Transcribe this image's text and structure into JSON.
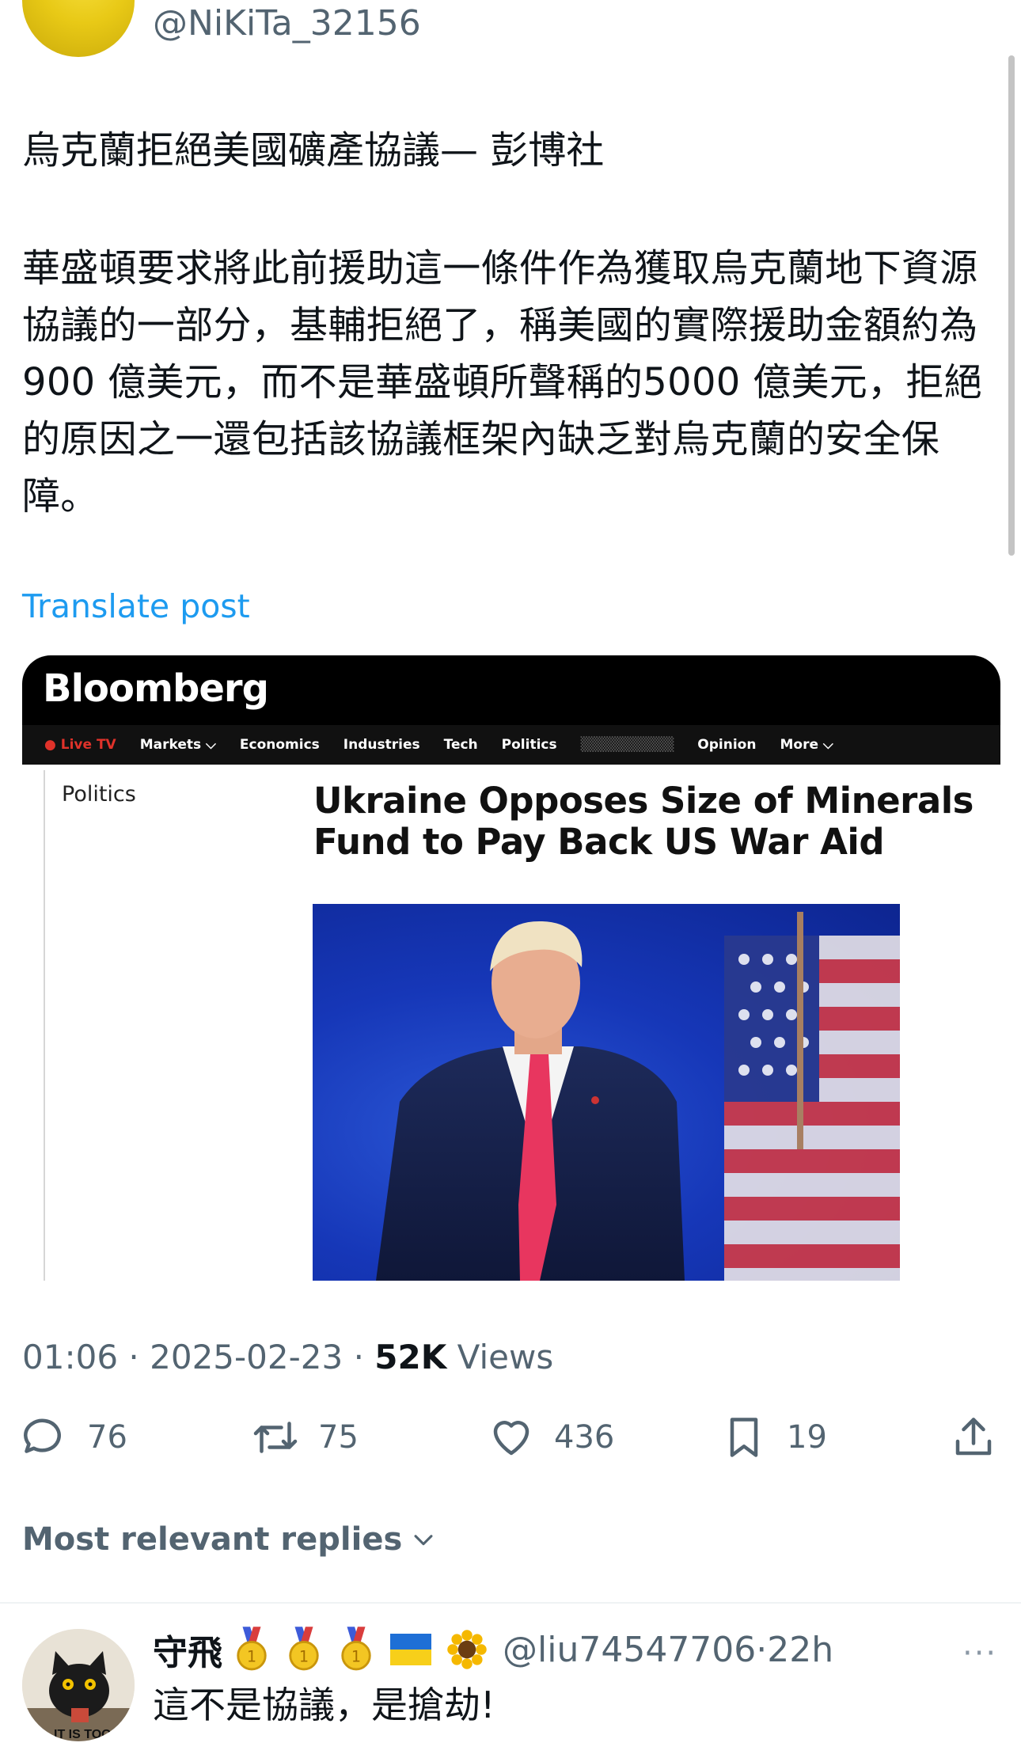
{
  "author": {
    "handle": "@NiKiTa_32156"
  },
  "post": {
    "title": "烏克蘭拒絕美國礦產協議— 彭博社",
    "body": "華盛頓要求將此前援助這一條件作為獲取烏克蘭地下資源協議的一部分，基輔拒絕了，稱美國的實際援助金額約為 900 億美元，而不是華盛頓所聲稱的5000 億美元，拒絕的原因之一還包括該協議框架內缺乏對烏克蘭的安全保障。",
    "translate_label": "Translate post"
  },
  "embed": {
    "brand": "Bloomberg",
    "nav": [
      "● Live TV",
      "Markets ⌵",
      "Economics",
      "Industries",
      "Tech",
      "Politics",
      "Opinion",
      "More ⌵"
    ],
    "section": "Politics",
    "headline": "Ukraine Opposes Size of Minerals Fund to Pay Back US War Aid"
  },
  "meta": {
    "time": "01:06",
    "date": "2025-02-23",
    "views_count": "52K",
    "views_label": "Views",
    "separator": "·"
  },
  "actions": {
    "replies": "76",
    "reposts": "75",
    "likes": "436",
    "bookmarks": "19"
  },
  "replies_filter": {
    "label": "Most relevant replies"
  },
  "reply": {
    "name": "守飛",
    "handle": "@liu74547706",
    "age": "22h",
    "text": "這不是協議，是搶劫!",
    "more": "···",
    "avatar_caption": "IT IS TOO",
    "separator": "·"
  },
  "colors": {
    "link": "#1d9bf0",
    "muted": "#536471",
    "bloomberg_bg": "#000000",
    "live": "#e0322a"
  }
}
